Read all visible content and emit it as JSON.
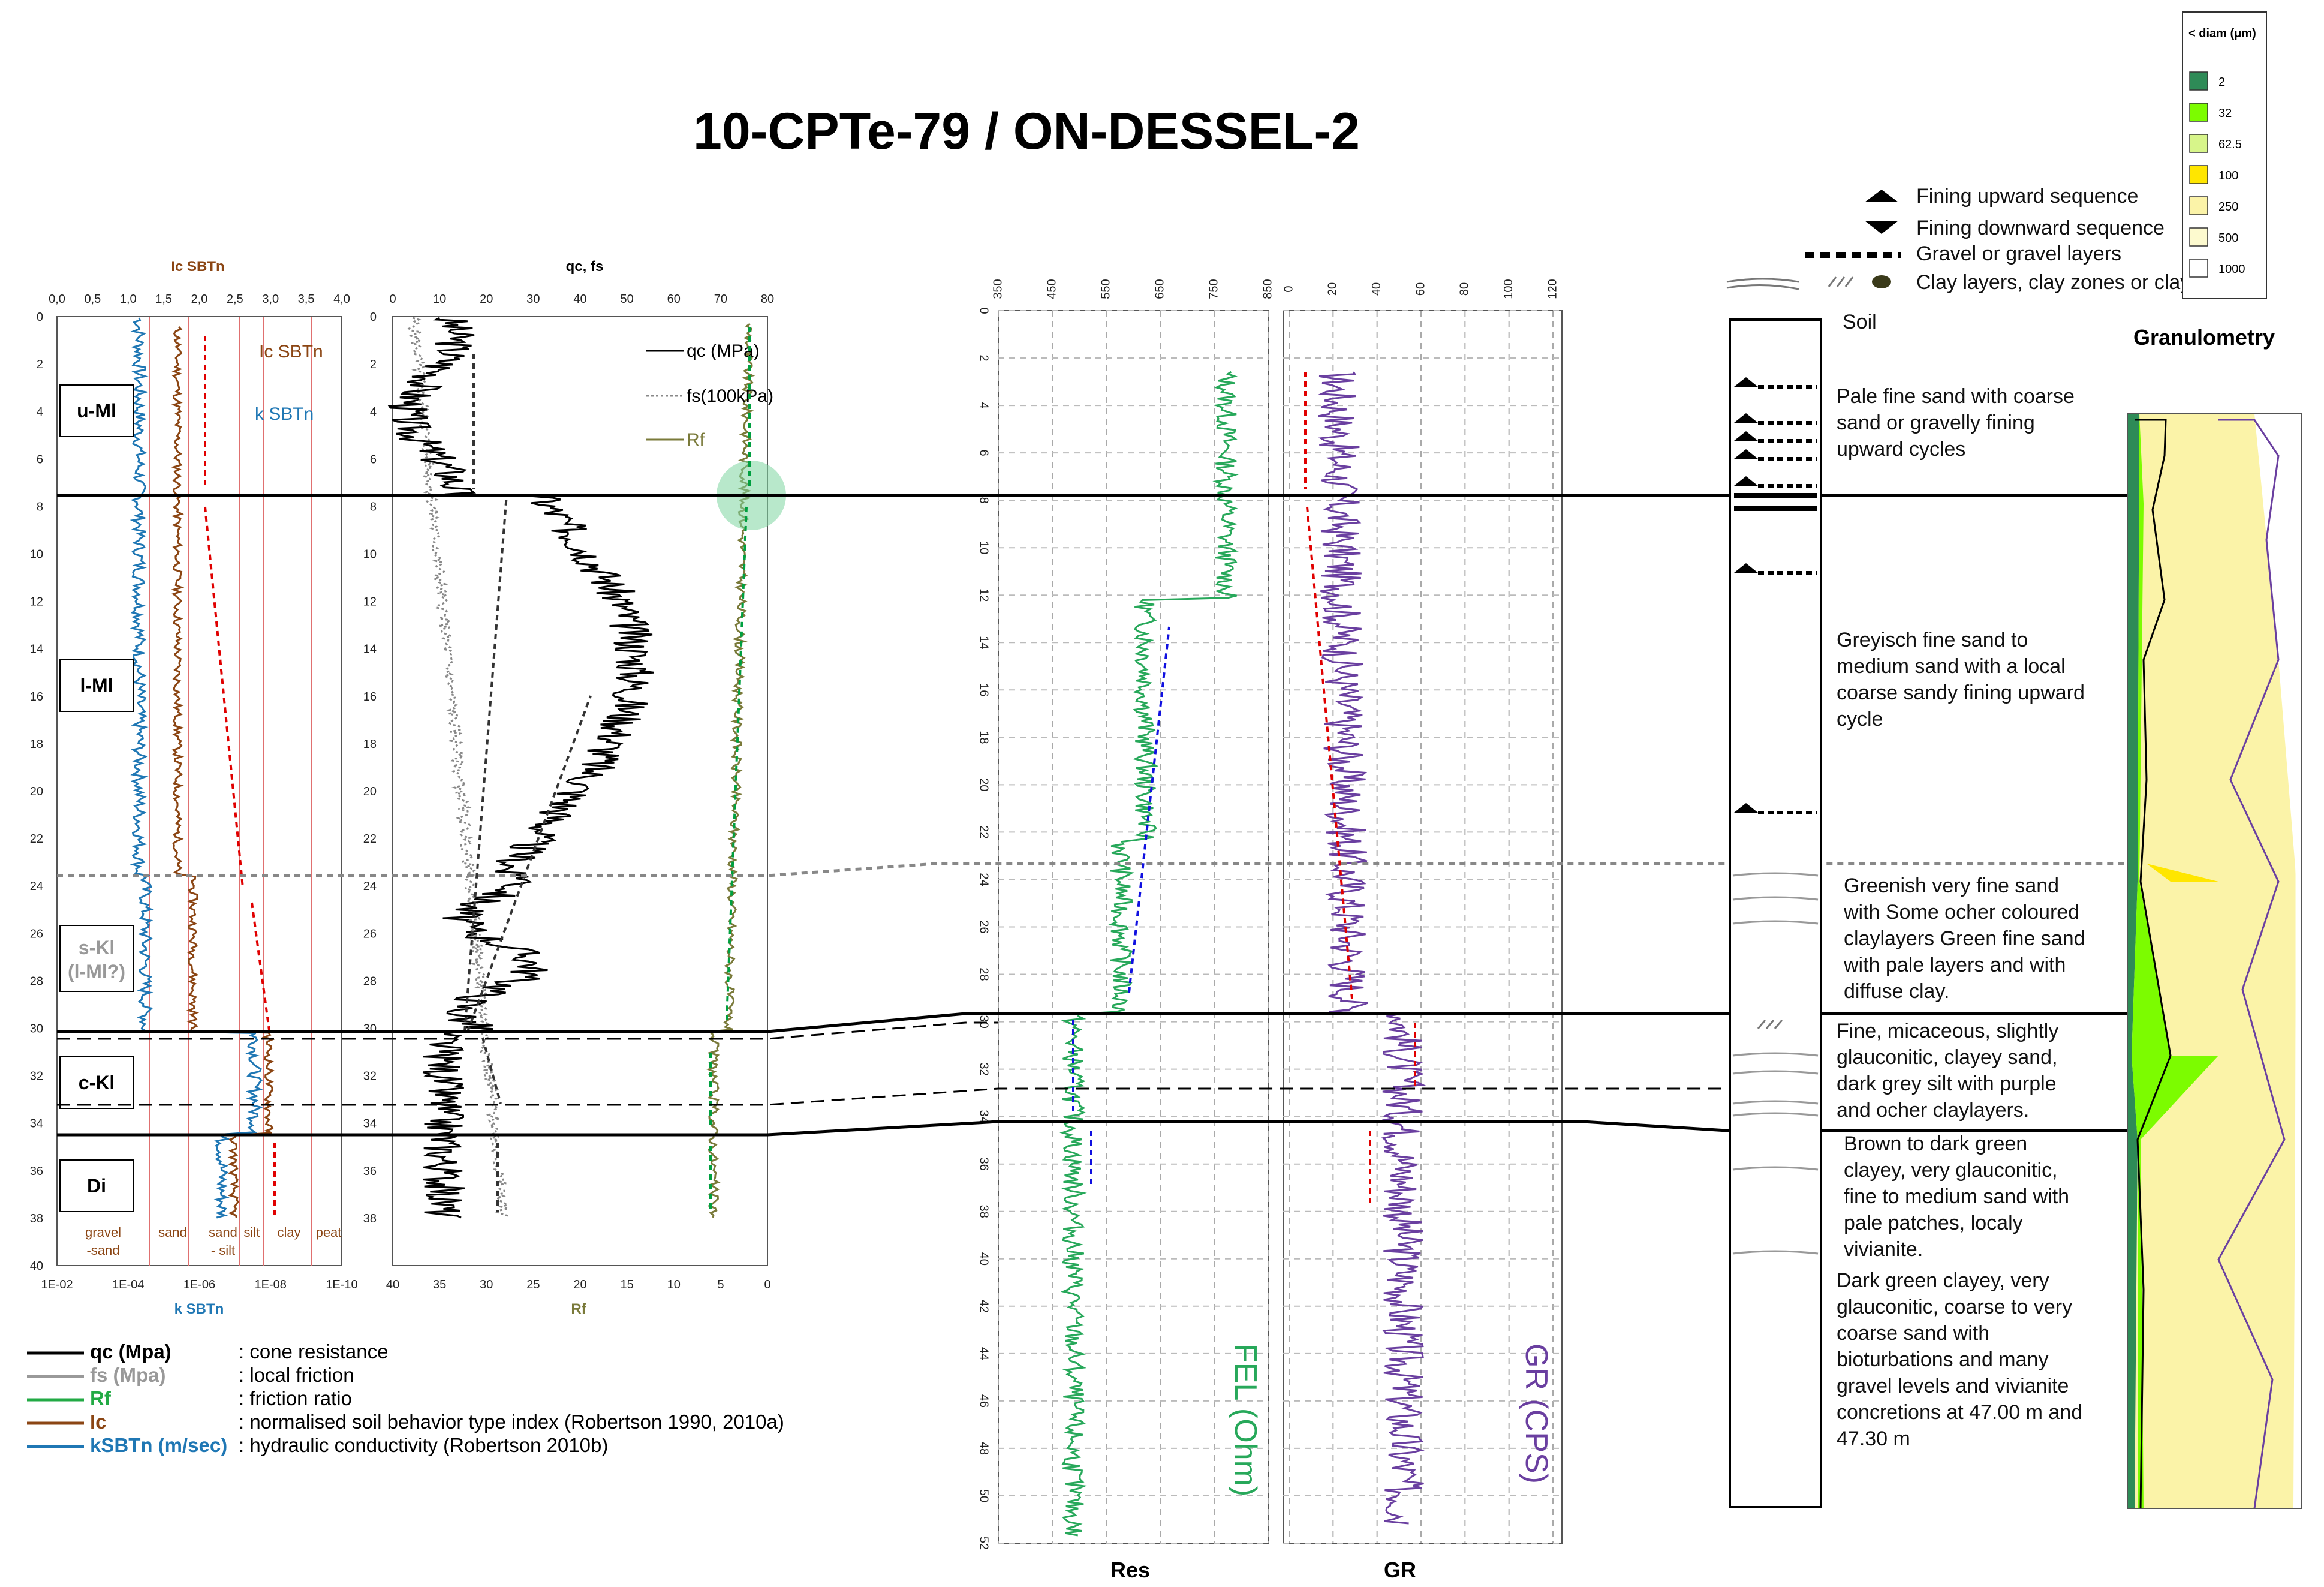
{
  "title": "10-CPTe-79 / ON-DESSEL-2",
  "chart_data": [
    {
      "type": "line",
      "panel": "Ic / kSBTn",
      "xlabel_top": "Ic SBTn",
      "xlabel_bottom": "k SBTn",
      "top_ticks": [
        "0,0",
        "0,5",
        "1,0",
        "1,5",
        "2,0",
        "2,5",
        "3,0",
        "3,5",
        "4,0"
      ],
      "bottom_ticks": [
        "1E-02",
        "1E-04",
        "1E-06",
        "1E-08",
        "1E-10"
      ],
      "depth_ticks": [
        "0",
        "2",
        "4",
        "6",
        "8",
        "10",
        "12",
        "14",
        "16",
        "18",
        "20",
        "22",
        "24",
        "26",
        "28",
        "30",
        "32",
        "34",
        "36",
        "38",
        "40"
      ],
      "ylim": [
        0,
        40
      ],
      "series": [
        {
          "name": "Ic SBTn",
          "color": "#8B4513"
        },
        {
          "name": "k SBTn",
          "color": "#1F77B4"
        }
      ],
      "zones": [
        "gravel\n-sand",
        "sand",
        "sand\n- silt",
        "silt",
        "clay",
        "peat"
      ],
      "units": [
        "u-Ml",
        "l-Ml",
        "s-Kl\n(l-Ml?)",
        "c-Kl",
        "Di"
      ]
    },
    {
      "type": "line",
      "panel": "qc, fs, Rf",
      "xlabel_top": "qc, fs",
      "xlabel_bottom": "Rf",
      "top_ticks": [
        "0",
        "10",
        "20",
        "30",
        "40",
        "50",
        "60",
        "70",
        "80"
      ],
      "bottom_ticks": [
        "40",
        "35",
        "30",
        "25",
        "20",
        "15",
        "10",
        "5",
        "0"
      ],
      "depth_ticks": [
        "0",
        "2",
        "4",
        "6",
        "8",
        "10",
        "12",
        "14",
        "16",
        "18",
        "20",
        "22",
        "24",
        "26",
        "28",
        "30",
        "32",
        "34",
        "36",
        "38"
      ],
      "ylim": [
        0,
        40
      ],
      "series": [
        {
          "name": "qc (MPa)",
          "color": "#000000"
        },
        {
          "name": "fs(100kPa)",
          "color": "#888888"
        },
        {
          "name": "Rf",
          "color": "#7A7A3A"
        }
      ]
    },
    {
      "type": "line",
      "panel": "Res",
      "xlabel": "Res",
      "series_label": "FEL (Ohm)",
      "top_ticks": [
        "350",
        "450",
        "550",
        "650",
        "750",
        "850"
      ],
      "depth_ticks": [
        "0",
        "2",
        "4",
        "6",
        "8",
        "10",
        "12",
        "14",
        "16",
        "18",
        "20",
        "22",
        "24",
        "26",
        "28",
        "30",
        "32",
        "34",
        "36",
        "38",
        "40",
        "42",
        "44",
        "46",
        "48",
        "50",
        "52"
      ],
      "ylim": [
        0,
        52
      ],
      "series": [
        {
          "name": "FEL (Ohm)",
          "color": "#27A85A"
        }
      ]
    },
    {
      "type": "line",
      "panel": "GR",
      "xlabel": "GR",
      "series_label": "GR (CPS)",
      "top_ticks": [
        "0",
        "20",
        "40",
        "60",
        "80",
        "100",
        "120"
      ],
      "ylim": [
        0,
        52
      ],
      "series": [
        {
          "name": "GR (CPS)",
          "color": "#6A3FA0"
        }
      ]
    }
  ],
  "legend": [
    {
      "key": "qc (Mpa)",
      "desc": ": cone resistance",
      "color": "#000000"
    },
    {
      "key": "fs (Mpa)",
      "desc": ": local friction",
      "color": "#999999"
    },
    {
      "key": "Rf",
      "desc": ": friction ratio",
      "color": "#22AA44"
    },
    {
      "key": "Ic",
      "desc": ": normalised soil behavior type index (Robertson 1990, 2010a)",
      "color": "#8B4513"
    },
    {
      "key": "kSBTn (m/sec)",
      "desc": ": hydraulic conductivity (Robertson 2010b)",
      "color": "#1F77B4"
    }
  ],
  "symbols": [
    "Fining upward sequence",
    "Fining downward sequence",
    "Gravel or gravel layers",
    "Clay layers, clay zones or clay nodules"
  ],
  "soil_label": "Soil",
  "descriptions": [
    "Pale fine sand with coarse sand or gravelly fining upward cycles",
    "Greyisch fine sand to medium sand with a local coarse sandy fining upward cycle",
    "Greenish very fine sand with Some ocher coloured claylayers Green fine sand with pale layers and with diffuse clay.",
    "Fine, micaceous, slightly glauconitic, clayey sand, dark grey silt with  purple and ocher claylayers.",
    "Brown to dark green clayey, very glauconitic, fine to medium sand with pale patches, localy vivianite.",
    "Dark green clayey, very glauconitic, coarse to very coarse  sand with bioturbations and many gravel levels and vivianite concretions at 47.00 m and 47.30 m"
  ],
  "granulometry": {
    "title": "Granulometry",
    "legend_title": "< diam (μm)",
    "classes": [
      {
        "label": "2",
        "color": "#2E8B57"
      },
      {
        "label": "32",
        "color": "#7CFC00"
      },
      {
        "label": "62.5",
        "color": "#D7F58A"
      },
      {
        "label": "100",
        "color": "#FFE600"
      },
      {
        "label": "250",
        "color": "#FBF3A8"
      },
      {
        "label": "500",
        "color": "#FDFACF"
      },
      {
        "label": "1000",
        "color": "#FFFFFF"
      }
    ]
  }
}
